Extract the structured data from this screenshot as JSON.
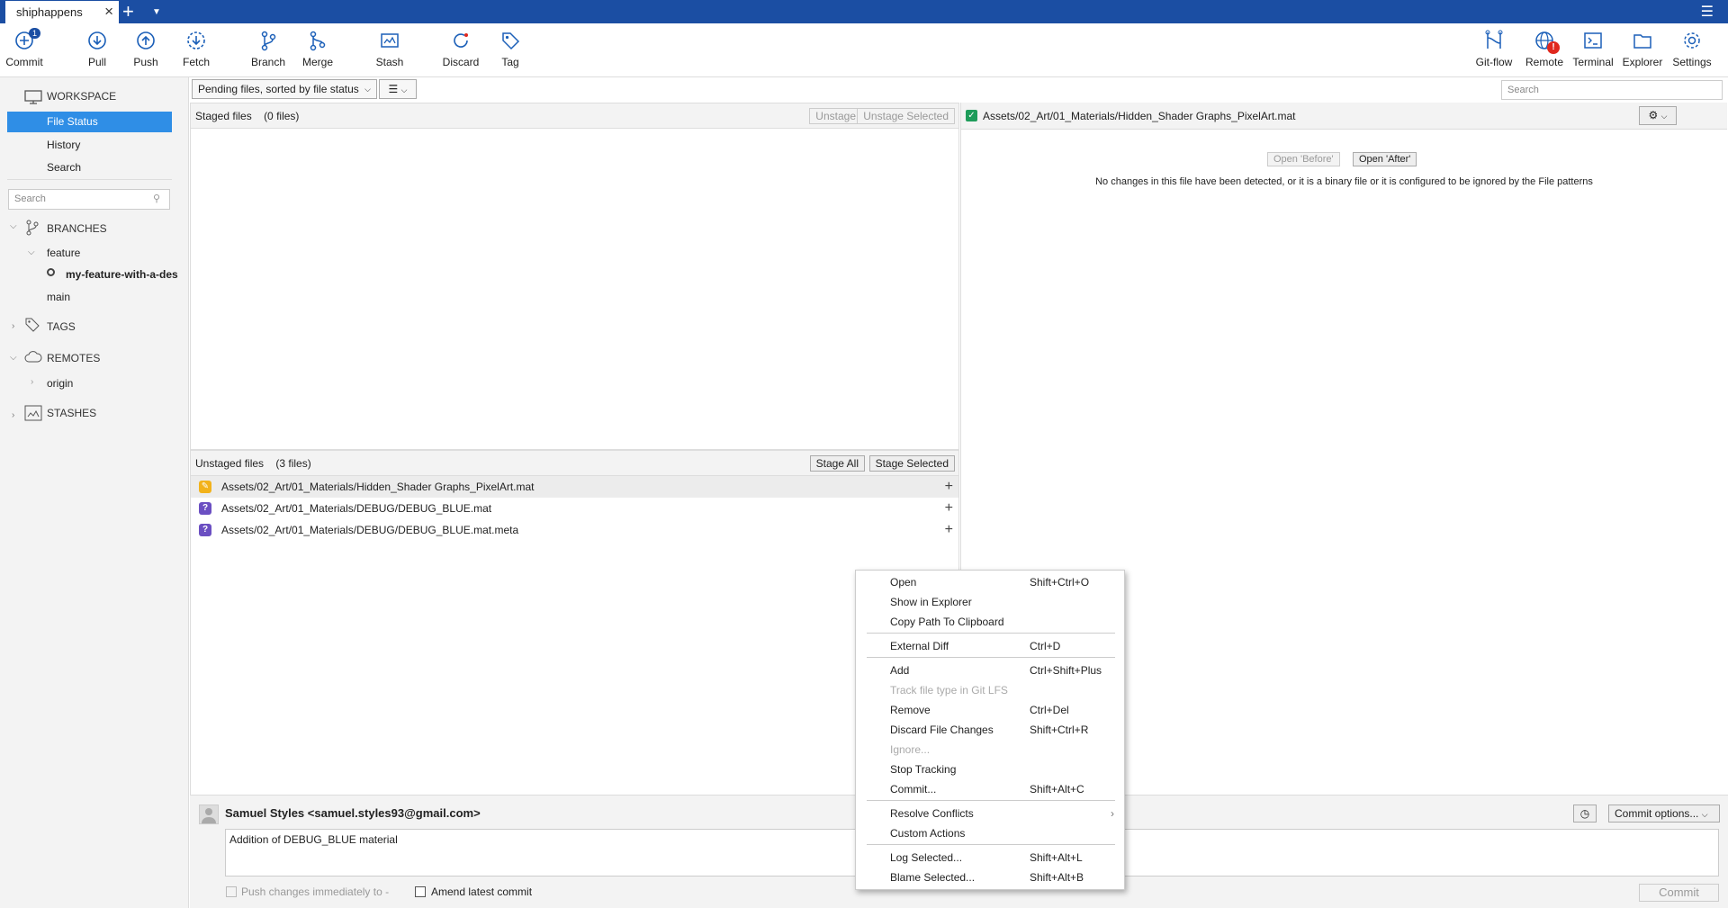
{
  "tab": {
    "title": "shiphappens"
  },
  "toolbar": {
    "commit": "Commit",
    "commit_badge": "1",
    "pull": "Pull",
    "push": "Push",
    "fetch": "Fetch",
    "branch": "Branch",
    "merge": "Merge",
    "stash": "Stash",
    "discard": "Discard",
    "tag": "Tag",
    "gitflow": "Git-flow",
    "remote": "Remote",
    "remote_badge": "!",
    "terminal": "Terminal",
    "explorer": "Explorer",
    "settings": "Settings"
  },
  "sidebar": {
    "workspace": "WORKSPACE",
    "file_status": "File Status",
    "history": "History",
    "search": "Search",
    "search_placeholder": "Search",
    "branches": "BRANCHES",
    "feature": "feature",
    "current_branch": "my-feature-with-a-des",
    "main": "main",
    "tags": "TAGS",
    "remotes": "REMOTES",
    "origin": "origin",
    "stashes": "STASHES"
  },
  "main": {
    "filter": "Pending files, sorted by file status",
    "search_placeholder": "Search"
  },
  "staged": {
    "title": "Staged files",
    "count": "(0 files)",
    "unstage_all": "Unstage All",
    "unstage_selected": "Unstage Selected"
  },
  "unstaged": {
    "title": "Unstaged files",
    "count": "(3 files)",
    "stage_all": "Stage All",
    "stage_selected": "Stage Selected",
    "files": [
      "Assets/02_Art/01_Materials/Hidden_Shader Graphs_PixelArt.mat",
      "Assets/02_Art/01_Materials/DEBUG/DEBUG_BLUE.mat",
      "Assets/02_Art/01_Materials/DEBUG/DEBUG_BLUE.mat.meta"
    ]
  },
  "diff": {
    "file": "Assets/02_Art/01_Materials/Hidden_Shader Graphs_PixelArt.mat",
    "open_before": "Open 'Before'",
    "open_after": "Open 'After'",
    "message": "No changes in this file have been detected, or it is a binary file or it is configured to be ignored by the File patterns"
  },
  "commit": {
    "author": "Samuel Styles <samuel.styles93@gmail.com>",
    "message": "Addition of DEBUG_BLUE material",
    "push_label": "Push changes immediately to -",
    "amend_label": "Amend latest commit",
    "options": "Commit options...",
    "commit_btn": "Commit"
  },
  "menu": [
    {
      "label": "Open",
      "key": "Shift+Ctrl+O"
    },
    {
      "label": "Show in Explorer",
      "key": ""
    },
    {
      "label": "Copy Path To Clipboard",
      "key": ""
    },
    {
      "label": "External Diff",
      "key": "Ctrl+D"
    },
    {
      "label": "Add",
      "key": "Ctrl+Shift+Plus"
    },
    {
      "label": "Track file type in Git LFS",
      "key": ""
    },
    {
      "label": "Remove",
      "key": "Ctrl+Del"
    },
    {
      "label": "Discard File Changes",
      "key": "Shift+Ctrl+R"
    },
    {
      "label": "Ignore...",
      "key": ""
    },
    {
      "label": "Stop Tracking",
      "key": ""
    },
    {
      "label": "Commit...",
      "key": "Shift+Alt+C"
    },
    {
      "label": "Resolve Conflicts",
      "key": ""
    },
    {
      "label": "Custom Actions",
      "key": ""
    },
    {
      "label": "Log Selected...",
      "key": "Shift+Alt+L"
    },
    {
      "label": "Blame Selected...",
      "key": "Shift+Alt+B"
    }
  ]
}
